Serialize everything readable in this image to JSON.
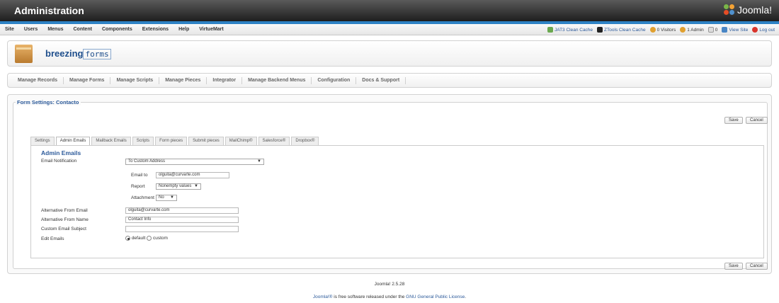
{
  "header": {
    "title": "Administration",
    "logo_text": "Joomla!"
  },
  "menu": [
    "Site",
    "Users",
    "Menus",
    "Content",
    "Components",
    "Extensions",
    "Help",
    "VirtueMart"
  ],
  "status": {
    "jat3": "JAT3 Clean Cache",
    "ztools": "ZTools Clean Cache",
    "visitors": "0 Visitors",
    "admins": "1 Admin",
    "messages": "0",
    "view_site": "View Site",
    "logout": "Log out"
  },
  "brand": {
    "part1": "breezing",
    "part2": "forms"
  },
  "subnav": [
    "Manage Records",
    "Manage Forms",
    "Manage Scripts",
    "Manage Pieces",
    "Integrator",
    "Manage Backend Menus",
    "Configuration",
    "Docs & Support"
  ],
  "form": {
    "legend": "Form Settings: Contacto",
    "save_label": "Save",
    "cancel_label": "Cancel",
    "tabs": [
      "Settings",
      "Admin Emails",
      "Mailback Emails",
      "Scripts",
      "Form pieces",
      "Submit pieces",
      "MailChimp®",
      "Salesforce®",
      "Dropbox®"
    ],
    "active_tab": "Admin Emails",
    "panel_title": "Admin Emails",
    "email_notification_label": "Email Notification",
    "email_notification_value": "To Custom Address",
    "email_to_label": "Email to",
    "email_to_value": "olguita@curvarte.com",
    "report_label": "Report",
    "report_value": "Nonempty values",
    "attachment_label": "Attachment",
    "attachment_value": "No",
    "alt_from_email_label": "Alternative From Email",
    "alt_from_email_value": "olguita@curvarte.com",
    "alt_from_name_label": "Alternative From Name",
    "alt_from_name_value": "Contact Info",
    "custom_subject_label": "Custom Email Subject",
    "custom_subject_value": "",
    "edit_emails_label": "Edit Emails",
    "edit_default": "default",
    "edit_custom": "custom"
  },
  "footer": {
    "version": "Joomla! 2.5.28",
    "license_prefix": "Joomla!®",
    "license_mid": " is free software released under the ",
    "license_link": "GNU General Public License",
    "license_end": "."
  },
  "colors": {
    "accent": "#2e82c5",
    "link": "#2c5a9a",
    "header_dark": "#1e1e1e"
  }
}
